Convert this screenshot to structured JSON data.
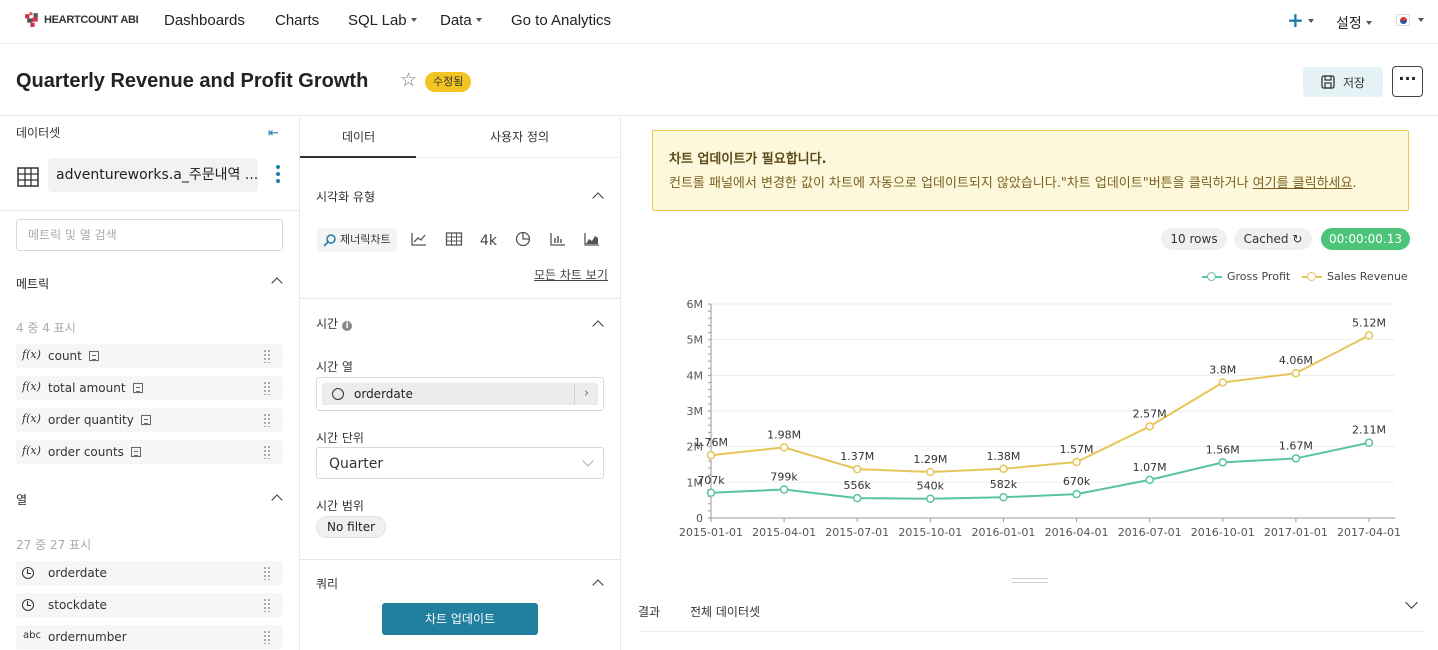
{
  "nav": {
    "logo": "HEARTCOUNT ABI",
    "items": [
      "Dashboards",
      "Charts",
      "SQL Lab",
      "Data",
      "Go to Analytics"
    ],
    "settings": "설정"
  },
  "header": {
    "title": "Quarterly Revenue and Profit Growth",
    "badge": "수정됨",
    "save_label": "저장",
    "more": "···"
  },
  "left": {
    "dataset_label": "데이터셋",
    "dataset_name": "adventureworks.a_주문내역 ...",
    "search_placeholder": "메트릭 및 열 검색",
    "metrics_title": "메트릭",
    "metrics_count": "4 중 4 표시",
    "metrics": [
      "count",
      "total amount",
      "order quantity",
      "order counts"
    ],
    "columns_title": "열",
    "columns_count": "27 중 27 표시",
    "columns": [
      {
        "type": "time",
        "name": "orderdate"
      },
      {
        "type": "time",
        "name": "stockdate"
      },
      {
        "type": "abc",
        "name": "ordernumber"
      }
    ]
  },
  "middle": {
    "tabs": [
      "데이터",
      "사용자 정의"
    ],
    "viz_type_label": "시각화 유형",
    "viz_selected": "제너릭차트",
    "viz_k4": "4k",
    "all_charts": "모든 차트 보기",
    "time_section": "시간",
    "time_column_label": "시간 열",
    "time_column_value": "orderdate",
    "time_grain_label": "시간 단위",
    "time_grain_value": "Quarter",
    "time_range_label": "시간 범위",
    "time_range_value": "No filter",
    "query_section": "쿼리",
    "update_button": "차트 업데이트"
  },
  "alert": {
    "title": "차트 업데이트가 필요합니다.",
    "message": "컨트롤 패널에서 변경한 값이 차트에 자동으로 업데이트되지 않았습니다.\"차트 업데이트\"버튼을 클릭하거나 ",
    "link": "여기를 클릭하세요",
    "suffix": "."
  },
  "status": {
    "rows": "10 rows",
    "cached": "Cached",
    "timer": "00:00:00.13"
  },
  "results": {
    "tabs": [
      "결과",
      "전체 데이터셋"
    ]
  },
  "colors": {
    "gross_profit": "#5cc2a6",
    "sales_revenue": "#e7c45a",
    "accent": "#20809e",
    "timer_bg": "#4cc47a"
  },
  "chart_data": {
    "type": "line",
    "x": [
      "2015-01-01",
      "2015-04-01",
      "2015-07-01",
      "2015-10-01",
      "2016-01-01",
      "2016-04-01",
      "2016-07-01",
      "2016-10-01",
      "2017-01-01",
      "2017-04-01"
    ],
    "series": [
      {
        "name": "Gross Profit",
        "values": [
          707000,
          799000,
          556000,
          540000,
          582000,
          670000,
          1070000,
          1560000,
          1670000,
          2110000
        ],
        "labels": [
          "707k",
          "799k",
          "556k",
          "540k",
          "582k",
          "670k",
          "1.07M",
          "1.56M",
          "1.67M",
          "2.11M"
        ]
      },
      {
        "name": "Sales Revenue",
        "values": [
          1760000,
          1980000,
          1370000,
          1290000,
          1380000,
          1570000,
          2570000,
          3800000,
          4060000,
          5120000
        ],
        "labels": [
          "1.76M",
          "1.98M",
          "1.37M",
          "1.29M",
          "1.38M",
          "1.57M",
          "2.57M",
          "3.8M",
          "4.06M",
          "5.12M"
        ]
      }
    ],
    "y_ticks": [
      "0",
      "1M",
      "2M",
      "3M",
      "4M",
      "5M",
      "6M"
    ],
    "ylim": [
      0,
      6000000
    ],
    "legend": "top-right",
    "grid": true
  }
}
